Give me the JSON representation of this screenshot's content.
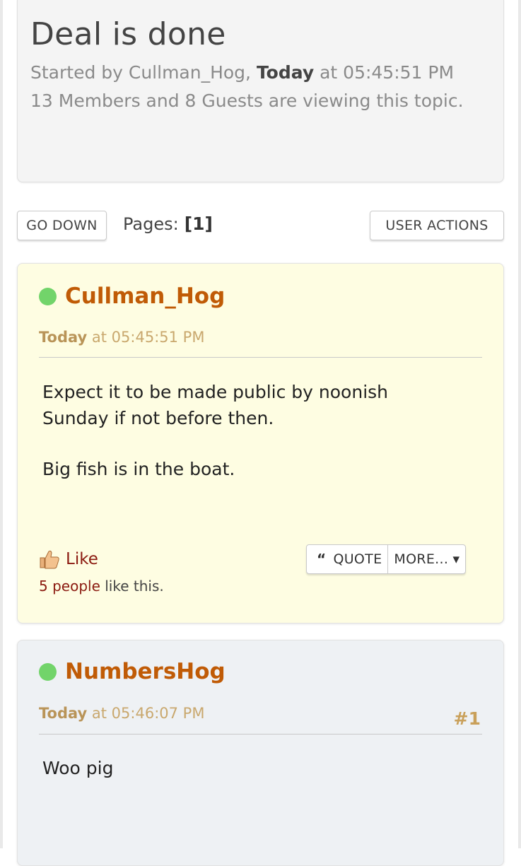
{
  "topic": {
    "title": "Deal is done",
    "started_prefix": "Started by Cullman_Hog, ",
    "started_day": "Today",
    "started_time": " at 05:45:51 PM",
    "viewers": "13 Members and 8 Guests are viewing this topic."
  },
  "nav": {
    "go_down_label": "GO DOWN",
    "pages_label": "Pages:",
    "current_page": "[1]",
    "user_actions_label": "USER ACTIONS"
  },
  "posts": [
    {
      "author": "Cullman_Hog",
      "day": "Today",
      "time": " at 05:45:51 PM",
      "number": "",
      "body": [
        "Expect it to be made public by noonish Sunday if not before then.",
        "Big fish is in the boat."
      ],
      "like_label": "Like",
      "likes_count": "5 people",
      "likes_suffix": " like this.",
      "quote_glyph": "“",
      "quote_label": "QUOTE",
      "more_label": "MORE... ▾"
    },
    {
      "author": "NumbersHog",
      "day": "Today",
      "time": " at 05:46:07 PM",
      "number": "#1",
      "body": [
        "Woo pig"
      ]
    }
  ],
  "colors": {
    "username": "#c05b06",
    "online": "#72d46a",
    "post_bg_highlight": "#fefde2",
    "post_bg": "#eef1f4",
    "link": "#8b1a10"
  },
  "icons": {
    "like": "thumbs-up-icon",
    "online": "online-status-icon",
    "quote": "quote-icon"
  }
}
